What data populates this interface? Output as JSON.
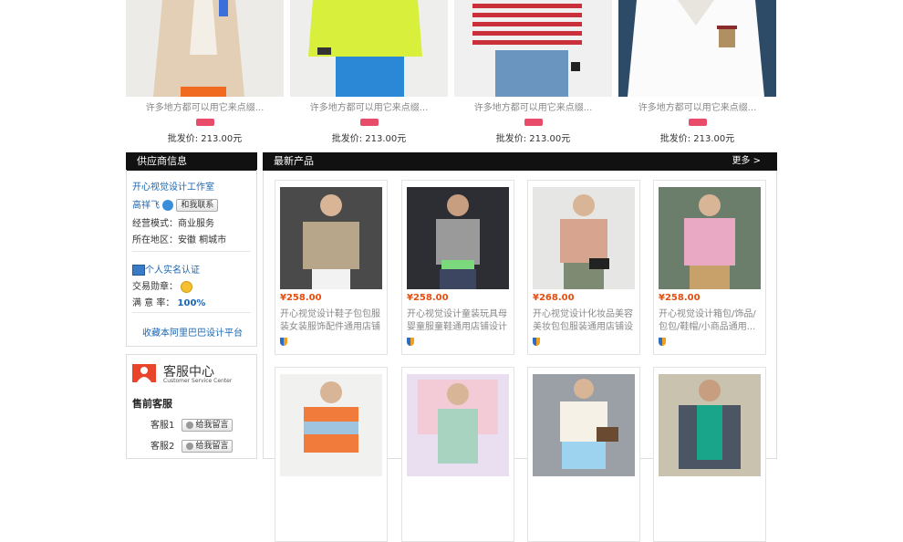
{
  "top_products": [
    {
      "title": "许多地方都可以用它来点缀...",
      "price": "批发价: 213.00元"
    },
    {
      "title": "许多地方都可以用它来点缀...",
      "price": "批发价: 213.00元"
    },
    {
      "title": "许多地方都可以用它来点缀...",
      "price": "批发价: 213.00元"
    },
    {
      "title": "许多地方都可以用它来点缀...",
      "price": "批发价: 213.00元"
    }
  ],
  "supplier": {
    "header": "供应商信息",
    "shop_name": "开心视觉设计工作室",
    "contact_name": "高祥飞",
    "contact_button": "和我联系",
    "business_mode": "经营模式：商业服务",
    "location": "所在地区：安徽 桐城市",
    "verification": "个人实名认证",
    "trade_medal": "交易勋章：",
    "satisfaction_label": "满 意 率：",
    "satisfaction_value": "100%",
    "favorite_link": "收藏本阿里巴巴设计平台"
  },
  "service": {
    "title_cn": "客服中心",
    "title_en": "Customer Service Center",
    "presale": "售前客服",
    "agents": [
      {
        "name": "客服1",
        "button": "给我留言"
      },
      {
        "name": "客服2",
        "button": "给我留言"
      }
    ]
  },
  "latest": {
    "header": "最新产品",
    "more": "更多 >",
    "products": [
      {
        "price": "¥258.00",
        "title": "开心视觉设计鞋子包包服装女装服饰配件通用店铺设..."
      },
      {
        "price": "¥258.00",
        "title": "开心视觉设计童装玩具母婴童服童鞋通用店铺设计装..."
      },
      {
        "price": "¥268.00",
        "title": "开心视觉设计化妆品美容美妆包包服装通用店铺设计..."
      },
      {
        "price": "¥258.00",
        "title": "开心视觉设计箱包/饰品/包包/鞋帽/小商品通用..."
      },
      {
        "price": "",
        "title": ""
      },
      {
        "price": "",
        "title": ""
      },
      {
        "price": "",
        "title": ""
      },
      {
        "price": "",
        "title": ""
      }
    ]
  },
  "colors": {
    "accent_orange": "#e64d0e",
    "link_blue": "#1a66b3",
    "header_black": "#111111"
  }
}
